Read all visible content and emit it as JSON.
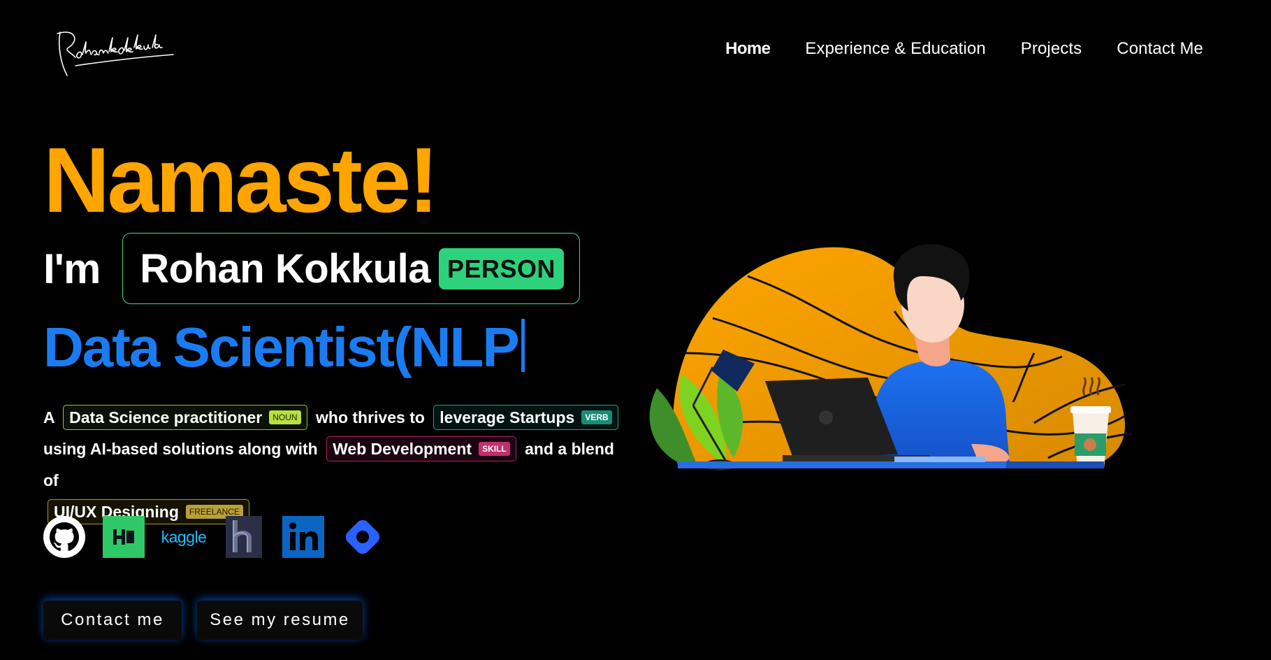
{
  "header": {
    "logo_text": "Rohankokkula",
    "nav": [
      {
        "label": "Home",
        "active": true
      },
      {
        "label": "Experience & Education",
        "active": false
      },
      {
        "label": "Projects",
        "active": false
      },
      {
        "label": "Contact Me",
        "active": false
      }
    ]
  },
  "hero": {
    "greeting": "Namaste!",
    "im_label": "I'm",
    "name": "Rohan Kokkula",
    "name_tag": "PERSON",
    "role": "Data Scientist(NLP",
    "description": {
      "part1": "A",
      "chip1": {
        "text": "Data Science practitioner",
        "tag": "NOUN"
      },
      "part2": "who thrives to",
      "chip2": {
        "text": "leverage Startups",
        "tag": "VERB"
      },
      "part3": "using AI-based solutions along with",
      "chip3": {
        "text": "Web Development",
        "tag": "SKILL"
      },
      "part4": "and a blend of",
      "chip4": {
        "text": "UI/UX Designing",
        "tag": "FREELANCE"
      }
    },
    "socials": [
      {
        "name": "GitHub",
        "icon": "github-icon"
      },
      {
        "name": "HackerRank",
        "icon": "hackerrank-icon"
      },
      {
        "name": "kaggle",
        "icon": "kaggle-icon"
      },
      {
        "name": "Hashnode",
        "icon": "hashnode-icon"
      },
      {
        "name": "LinkedIn",
        "icon": "linkedin-icon"
      },
      {
        "name": "Hashnode",
        "icon": "blog-icon"
      }
    ],
    "buttons": {
      "contact": "Contact me",
      "resume": "See my resume"
    }
  },
  "colors": {
    "background": "#000000",
    "greeting": "#ffa500",
    "role": "#1a7cf2",
    "name_border": "#3ddc84",
    "name_tag_bg": "#2ed27c"
  }
}
